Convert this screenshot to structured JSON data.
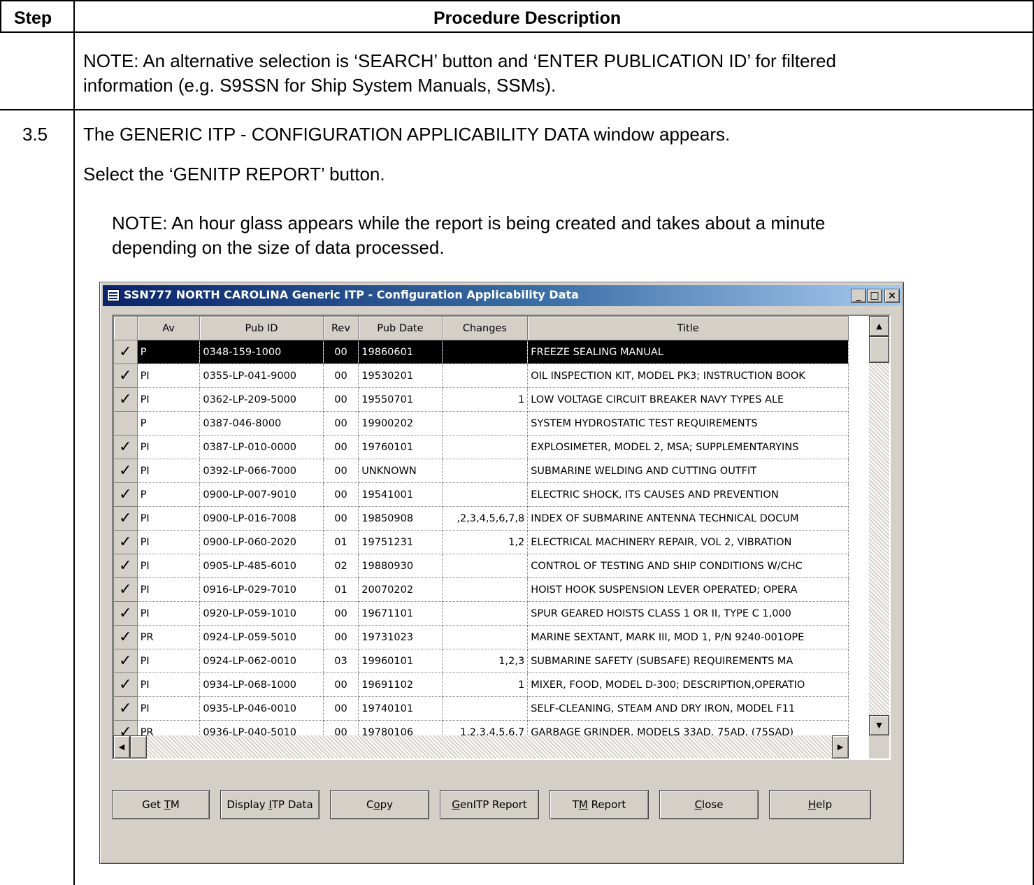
{
  "table": {
    "col_step": "Step",
    "col_procedure": "Procedure Description",
    "note1_line1": "NOTE: An alternative selection is ‘SEARCH’ button and ‘ENTER PUBLICATION ID’ for filtered",
    "note1_line2": "information (e.g. S9SSN for Ship System Manuals, SSMs).",
    "step_number": "3.5",
    "step_line1": "The GENERIC ITP - CONFIGURATION APPLICABILITY DATA window appears.",
    "step_line2": "Select the ‘GENITP REPORT’ button.",
    "note2_line1": "NOTE: An hour glass appears while the report is being created and takes about a minute",
    "note2_line2": "depending on the size of data processed."
  },
  "window": {
    "title": "SSN777 NORTH CAROLINA Generic ITP - Configuration Applicability Data",
    "minimize": "_",
    "maximize": "□",
    "close": "×"
  },
  "grid": {
    "headers": [
      "Av",
      "Pub ID",
      "Rev",
      "Pub Date",
      "Changes",
      "Title"
    ],
    "rows": [
      {
        "check": "✓",
        "av": "P",
        "pub_id": "0348-159-1000",
        "rev": "00",
        "date": "19860601",
        "changes": "",
        "title": "FREEZE SEALING MANUAL"
      },
      {
        "check": "✓",
        "av": "PI",
        "pub_id": "0355-LP-041-9000",
        "rev": "00",
        "date": "19530201",
        "changes": "",
        "title": "OIL INSPECTION KIT, MODEL PK3; INSTRUCTION BOOK"
      },
      {
        "check": "✓",
        "av": "PI",
        "pub_id": "0362-LP-209-5000",
        "rev": "00",
        "date": "19550701",
        "changes": "1",
        "title": "LOW VOLTAGE CIRCUIT BREAKER NAVY TYPES ALE"
      },
      {
        "check": "",
        "av": "P",
        "pub_id": "0387-046-8000",
        "rev": "00",
        "date": "19900202",
        "changes": "",
        "title": "SYSTEM HYDROSTATIC TEST REQUIREMENTS"
      },
      {
        "check": "✓",
        "av": "PI",
        "pub_id": "0387-LP-010-0000",
        "rev": "00",
        "date": "19760101",
        "changes": "",
        "title": "EXPLOSIMETER, MODEL 2, MSA; SUPPLEMENTARYINS"
      },
      {
        "check": "✓",
        "av": "PI",
        "pub_id": "0392-LP-066-7000",
        "rev": "00",
        "date": "UNKNOWN",
        "changes": "",
        "title": "SUBMARINE WELDING AND CUTTING OUTFIT"
      },
      {
        "check": "✓",
        "av": "P",
        "pub_id": "0900-LP-007-9010",
        "rev": "00",
        "date": "19541001",
        "changes": "",
        "title": "ELECTRIC SHOCK, ITS CAUSES AND PREVENTION"
      },
      {
        "check": "✓",
        "av": "PI",
        "pub_id": "0900-LP-016-7008",
        "rev": "00",
        "date": "19850908",
        "changes": ",2,3,4,5,6,7,8",
        "title": "INDEX OF SUBMARINE ANTENNA TECHNICAL DOCUM"
      },
      {
        "check": "✓",
        "av": "PI",
        "pub_id": "0900-LP-060-2020",
        "rev": "01",
        "date": "19751231",
        "changes": "1,2",
        "title": "ELECTRICAL MACHINERY REPAIR, VOL 2, VIBRATION"
      },
      {
        "check": "✓",
        "av": "PI",
        "pub_id": "0905-LP-485-6010",
        "rev": "02",
        "date": "19880930",
        "changes": "",
        "title": "CONTROL OF TESTING AND SHIP CONDITIONS W/CHC"
      },
      {
        "check": "✓",
        "av": "PI",
        "pub_id": "0916-LP-029-7010",
        "rev": "01",
        "date": "20070202",
        "changes": "",
        "title": "HOIST HOOK SUSPENSION LEVER OPERATED; OPERA"
      },
      {
        "check": "✓",
        "av": "PI",
        "pub_id": "0920-LP-059-1010",
        "rev": "00",
        "date": "19671101",
        "changes": "",
        "title": "SPUR GEARED HOISTS CLASS 1 OR II, TYPE C 1,000"
      },
      {
        "check": "✓",
        "av": "PR",
        "pub_id": "0924-LP-059-5010",
        "rev": "00",
        "date": "19731023",
        "changes": "",
        "title": "MARINE SEXTANT, MARK III, MOD 1, P/N 9240-001OPE"
      },
      {
        "check": "✓",
        "av": "PI",
        "pub_id": "0924-LP-062-0010",
        "rev": "03",
        "date": "19960101",
        "changes": "1,2,3",
        "title": "SUBMARINE SAFETY (SUBSAFE) REQUIREMENTS MA"
      },
      {
        "check": "✓",
        "av": "PI",
        "pub_id": "0934-LP-068-1000",
        "rev": "00",
        "date": "19691102",
        "changes": "1",
        "title": "MIXER, FOOD, MODEL D-300; DESCRIPTION,OPERATIO"
      },
      {
        "check": "✓",
        "av": "PI",
        "pub_id": "0935-LP-046-0010",
        "rev": "00",
        "date": "19740101",
        "changes": "",
        "title": "SELF-CLEANING, STEAM AND DRY IRON, MODEL F11"
      },
      {
        "check": "✓",
        "av": "PR",
        "pub_id": "0936-LP-040-5010",
        "rev": "00",
        "date": "19780106",
        "changes": "1,2,3,4,5,6,7",
        "title": "GARBAGE GRINDER, MODELS 33AD, 75AD, (75SAD)"
      }
    ]
  },
  "buttons": {
    "get_tm": {
      "pre": "Get ",
      "key": "T",
      "post": "M"
    },
    "display_itp": {
      "pre": "Display ",
      "key": "I",
      "post": "TP Data"
    },
    "copy": {
      "pre": "C",
      "key": "o",
      "post": "py"
    },
    "genitp": {
      "pre": "",
      "key": "G",
      "post": "enITP Report"
    },
    "tm_report": {
      "pre": "T",
      "key": "M",
      "post": " Report"
    },
    "close": {
      "pre": "",
      "key": "C",
      "post": "lose"
    },
    "help": {
      "pre": "",
      "key": "H",
      "post": "elp"
    }
  },
  "scroll": {
    "up": "▲",
    "down": "▼",
    "left": "◀",
    "right": "▶"
  }
}
